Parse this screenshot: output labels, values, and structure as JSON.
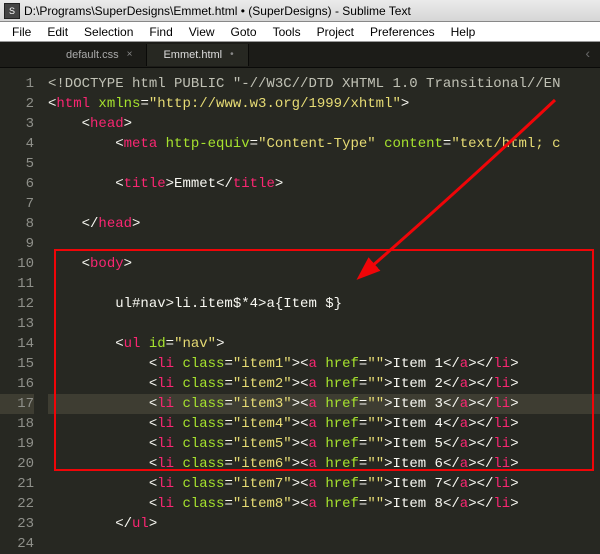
{
  "title": "D:\\Programs\\SuperDesigns\\Emmet.html • (SuperDesigns) - Sublime Text",
  "menu": [
    "File",
    "Edit",
    "Selection",
    "Find",
    "View",
    "Goto",
    "Tools",
    "Project",
    "Preferences",
    "Help"
  ],
  "tabs": [
    {
      "label": "default.css",
      "active": false
    },
    {
      "label": "Emmet.html",
      "active": true
    }
  ],
  "lines": [
    "1",
    "2",
    "3",
    "4",
    "5",
    "6",
    "7",
    "8",
    "9",
    "10",
    "11",
    "12",
    "13",
    "14",
    "15",
    "16",
    "17",
    "18",
    "19",
    "20",
    "21",
    "22",
    "23",
    "24"
  ],
  "code": {
    "doctype": "<!DOCTYPE html PUBLIC \"-//W3C//DTD XHTML 1.0 Transitional//EN",
    "html_open_attr": "xmlns",
    "html_open_val": "http://www.w3.org/1999/xhtml",
    "meta_attr1": "http-equiv",
    "meta_val1": "Content-Type",
    "meta_attr2": "content",
    "meta_val2": "text/html; c",
    "title_text": "Emmet",
    "emmet_abbr": "ul#nav>li.item$*4>a{Item $}",
    "ul_id_attr": "id",
    "ul_id_val": "nav",
    "li": [
      {
        "cls": "item1",
        "txt": "Item 1"
      },
      {
        "cls": "item2",
        "txt": "Item 2"
      },
      {
        "cls": "item3",
        "txt": "Item 3"
      },
      {
        "cls": "item4",
        "txt": "Item 4"
      },
      {
        "cls": "item5",
        "txt": "Item 5"
      },
      {
        "cls": "item6",
        "txt": "Item 6"
      },
      {
        "cls": "item7",
        "txt": "Item 7"
      },
      {
        "cls": "item8",
        "txt": "Item 8"
      }
    ]
  }
}
